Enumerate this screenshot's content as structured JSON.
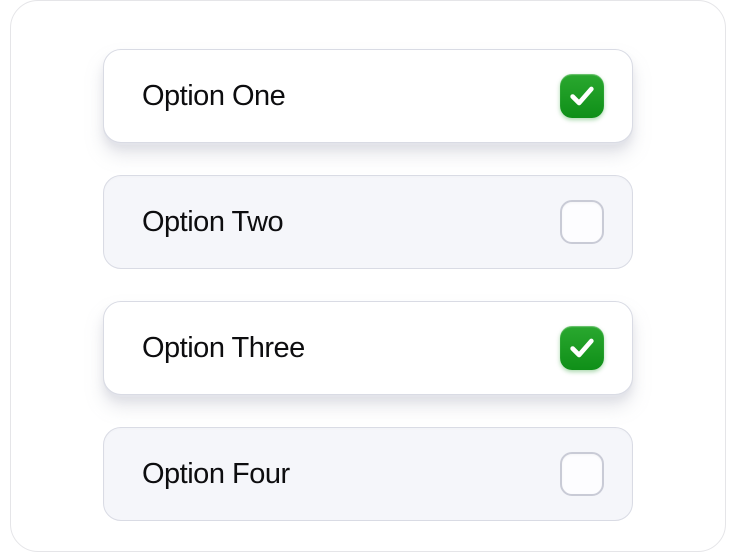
{
  "options": [
    {
      "label": "Option One",
      "checked": true
    },
    {
      "label": "Option Two",
      "checked": false
    },
    {
      "label": "Option Three",
      "checked": true
    },
    {
      "label": "Option Four",
      "checked": false
    }
  ],
  "colors": {
    "accent_checked": "#1b9a22",
    "card_border": "#e5e5e8",
    "row_border": "#d9dbe4",
    "row_bg_unchecked": "#f5f6fa"
  }
}
